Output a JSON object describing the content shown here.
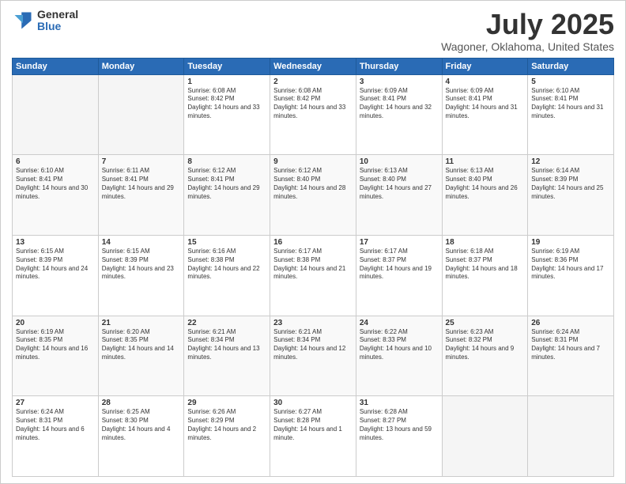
{
  "header": {
    "logo_general": "General",
    "logo_blue": "Blue",
    "main_title": "July 2025",
    "subtitle": "Wagoner, Oklahoma, United States"
  },
  "weekdays": [
    "Sunday",
    "Monday",
    "Tuesday",
    "Wednesday",
    "Thursday",
    "Friday",
    "Saturday"
  ],
  "weeks": [
    [
      {
        "day": "",
        "empty": true
      },
      {
        "day": "",
        "empty": true
      },
      {
        "day": "1",
        "sunrise": "6:08 AM",
        "sunset": "8:42 PM",
        "daylight": "14 hours and 33 minutes."
      },
      {
        "day": "2",
        "sunrise": "6:08 AM",
        "sunset": "8:42 PM",
        "daylight": "14 hours and 33 minutes."
      },
      {
        "day": "3",
        "sunrise": "6:09 AM",
        "sunset": "8:41 PM",
        "daylight": "14 hours and 32 minutes."
      },
      {
        "day": "4",
        "sunrise": "6:09 AM",
        "sunset": "8:41 PM",
        "daylight": "14 hours and 31 minutes."
      },
      {
        "day": "5",
        "sunrise": "6:10 AM",
        "sunset": "8:41 PM",
        "daylight": "14 hours and 31 minutes."
      }
    ],
    [
      {
        "day": "6",
        "sunrise": "6:10 AM",
        "sunset": "8:41 PM",
        "daylight": "14 hours and 30 minutes."
      },
      {
        "day": "7",
        "sunrise": "6:11 AM",
        "sunset": "8:41 PM",
        "daylight": "14 hours and 29 minutes."
      },
      {
        "day": "8",
        "sunrise": "6:12 AM",
        "sunset": "8:41 PM",
        "daylight": "14 hours and 29 minutes."
      },
      {
        "day": "9",
        "sunrise": "6:12 AM",
        "sunset": "8:40 PM",
        "daylight": "14 hours and 28 minutes."
      },
      {
        "day": "10",
        "sunrise": "6:13 AM",
        "sunset": "8:40 PM",
        "daylight": "14 hours and 27 minutes."
      },
      {
        "day": "11",
        "sunrise": "6:13 AM",
        "sunset": "8:40 PM",
        "daylight": "14 hours and 26 minutes."
      },
      {
        "day": "12",
        "sunrise": "6:14 AM",
        "sunset": "8:39 PM",
        "daylight": "14 hours and 25 minutes."
      }
    ],
    [
      {
        "day": "13",
        "sunrise": "6:15 AM",
        "sunset": "8:39 PM",
        "daylight": "14 hours and 24 minutes."
      },
      {
        "day": "14",
        "sunrise": "6:15 AM",
        "sunset": "8:39 PM",
        "daylight": "14 hours and 23 minutes."
      },
      {
        "day": "15",
        "sunrise": "6:16 AM",
        "sunset": "8:38 PM",
        "daylight": "14 hours and 22 minutes."
      },
      {
        "day": "16",
        "sunrise": "6:17 AM",
        "sunset": "8:38 PM",
        "daylight": "14 hours and 21 minutes."
      },
      {
        "day": "17",
        "sunrise": "6:17 AM",
        "sunset": "8:37 PM",
        "daylight": "14 hours and 19 minutes."
      },
      {
        "day": "18",
        "sunrise": "6:18 AM",
        "sunset": "8:37 PM",
        "daylight": "14 hours and 18 minutes."
      },
      {
        "day": "19",
        "sunrise": "6:19 AM",
        "sunset": "8:36 PM",
        "daylight": "14 hours and 17 minutes."
      }
    ],
    [
      {
        "day": "20",
        "sunrise": "6:19 AM",
        "sunset": "8:35 PM",
        "daylight": "14 hours and 16 minutes."
      },
      {
        "day": "21",
        "sunrise": "6:20 AM",
        "sunset": "8:35 PM",
        "daylight": "14 hours and 14 minutes."
      },
      {
        "day": "22",
        "sunrise": "6:21 AM",
        "sunset": "8:34 PM",
        "daylight": "14 hours and 13 minutes."
      },
      {
        "day": "23",
        "sunrise": "6:21 AM",
        "sunset": "8:34 PM",
        "daylight": "14 hours and 12 minutes."
      },
      {
        "day": "24",
        "sunrise": "6:22 AM",
        "sunset": "8:33 PM",
        "daylight": "14 hours and 10 minutes."
      },
      {
        "day": "25",
        "sunrise": "6:23 AM",
        "sunset": "8:32 PM",
        "daylight": "14 hours and 9 minutes."
      },
      {
        "day": "26",
        "sunrise": "6:24 AM",
        "sunset": "8:31 PM",
        "daylight": "14 hours and 7 minutes."
      }
    ],
    [
      {
        "day": "27",
        "sunrise": "6:24 AM",
        "sunset": "8:31 PM",
        "daylight": "14 hours and 6 minutes."
      },
      {
        "day": "28",
        "sunrise": "6:25 AM",
        "sunset": "8:30 PM",
        "daylight": "14 hours and 4 minutes."
      },
      {
        "day": "29",
        "sunrise": "6:26 AM",
        "sunset": "8:29 PM",
        "daylight": "14 hours and 2 minutes."
      },
      {
        "day": "30",
        "sunrise": "6:27 AM",
        "sunset": "8:28 PM",
        "daylight": "14 hours and 1 minute."
      },
      {
        "day": "31",
        "sunrise": "6:28 AM",
        "sunset": "8:27 PM",
        "daylight": "13 hours and 59 minutes."
      },
      {
        "day": "",
        "empty": true
      },
      {
        "day": "",
        "empty": true
      }
    ]
  ]
}
